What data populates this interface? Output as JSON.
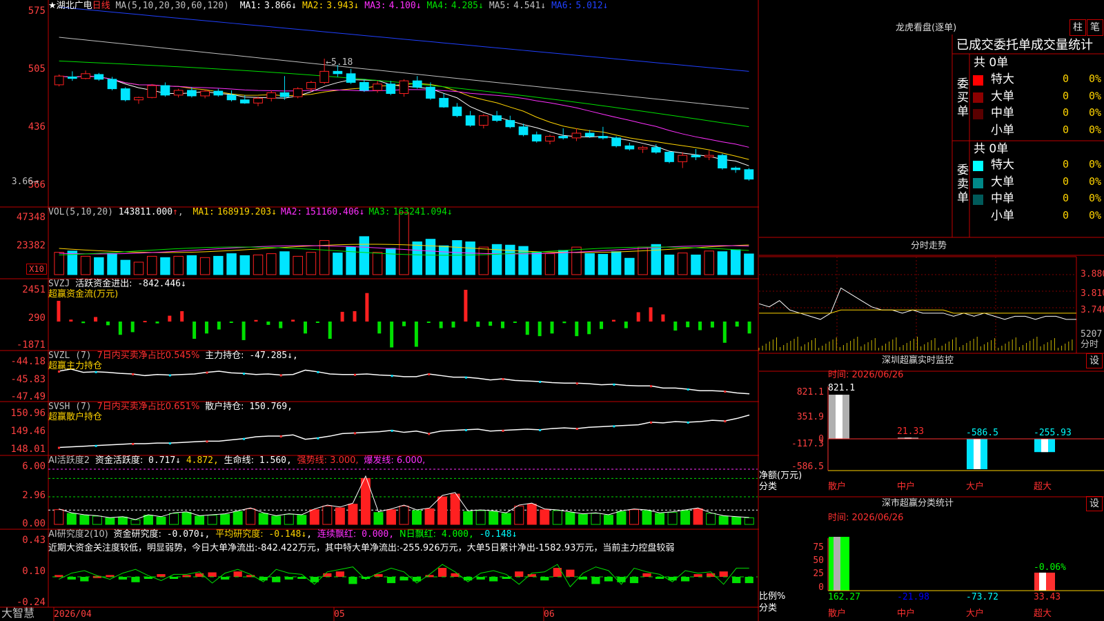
{
  "colors": {
    "up": "#ff2020",
    "down": "#00e5ff",
    "panel_border": "#c00000",
    "ma1": "#ffffff",
    "ma2": "#ffd400",
    "ma3": "#ff30ff",
    "ma4": "#00e000",
    "ma5": "#c0c0c0",
    "ma6": "#2040ff",
    "vol_label": "#c0c0c0"
  },
  "chart": {
    "stock_name": "★湖北广电",
    "period": "日线",
    "ma_params": "MA(5,10,20,30,60,120)",
    "ma": [
      {
        "label": "MA1:",
        "value": "3.866↓",
        "color": "#ffffff"
      },
      {
        "label": "MA2:",
        "value": "3.943↓",
        "color": "#ffd400"
      },
      {
        "label": "MA3:",
        "value": "4.100↓",
        "color": "#ff30ff"
      },
      {
        "label": "MA4:",
        "value": "4.285↓",
        "color": "#00e000"
      },
      {
        "label": "MA5:",
        "value": "4.541↓",
        "color": "#c0c0c0"
      },
      {
        "label": "MA6:",
        "value": "5.012↓",
        "color": "#2040ff"
      }
    ],
    "y_ticks": [
      "575",
      "505",
      "436",
      "366"
    ],
    "high_label": "5.18",
    "low_label": "3.66",
    "chart_data": {
      "type": "candlestick",
      "ylim": [
        3.5,
        5.85
      ],
      "high": 5.18,
      "low": 3.66,
      "ohlc": [
        [
          4.85,
          4.98,
          4.83,
          4.96
        ],
        [
          4.95,
          5.02,
          4.9,
          4.93
        ],
        [
          4.93,
          5.03,
          4.92,
          4.99
        ],
        [
          4.98,
          5.0,
          4.9,
          4.92
        ],
        [
          4.92,
          4.95,
          4.78,
          4.8
        ],
        [
          4.8,
          4.82,
          4.64,
          4.66
        ],
        [
          4.66,
          4.7,
          4.61,
          4.69
        ],
        [
          4.69,
          4.86,
          4.68,
          4.84
        ],
        [
          4.84,
          4.88,
          4.7,
          4.72
        ],
        [
          4.72,
          4.8,
          4.69,
          4.78
        ],
        [
          4.78,
          4.82,
          4.69,
          4.71
        ],
        [
          4.71,
          4.79,
          4.68,
          4.77
        ],
        [
          4.77,
          4.8,
          4.7,
          4.72
        ],
        [
          4.72,
          4.78,
          4.64,
          4.66
        ],
        [
          4.66,
          4.72,
          4.61,
          4.62
        ],
        [
          4.62,
          4.7,
          4.58,
          4.68
        ],
        [
          4.68,
          4.78,
          4.64,
          4.75
        ],
        [
          4.75,
          4.96,
          4.66,
          4.7
        ],
        [
          4.7,
          4.82,
          4.68,
          4.8
        ],
        [
          4.8,
          4.9,
          4.76,
          4.88
        ],
        [
          4.88,
          5.18,
          4.86,
          5.02
        ],
        [
          5.02,
          5.1,
          4.95,
          4.99
        ],
        [
          4.99,
          5.05,
          4.86,
          4.88
        ],
        [
          4.88,
          4.92,
          4.76,
          4.78
        ],
        [
          4.78,
          4.9,
          4.75,
          4.86
        ],
        [
          4.86,
          4.9,
          4.72,
          4.74
        ],
        [
          4.74,
          4.92,
          4.7,
          4.9
        ],
        [
          4.9,
          4.96,
          4.8,
          4.82
        ],
        [
          4.82,
          4.88,
          4.66,
          4.68
        ],
        [
          4.68,
          4.74,
          4.56,
          4.57
        ],
        [
          4.57,
          4.62,
          4.44,
          4.46
        ],
        [
          4.46,
          4.52,
          4.32,
          4.34
        ],
        [
          4.34,
          4.48,
          4.3,
          4.46
        ],
        [
          4.46,
          4.52,
          4.38,
          4.4
        ],
        [
          4.4,
          4.46,
          4.3,
          4.32
        ],
        [
          4.32,
          4.36,
          4.2,
          4.22
        ],
        [
          4.22,
          4.26,
          4.12,
          4.14
        ],
        [
          4.14,
          4.22,
          4.1,
          4.2
        ],
        [
          4.2,
          4.3,
          4.16,
          4.18
        ],
        [
          4.18,
          4.3,
          4.14,
          4.24
        ],
        [
          4.24,
          4.28,
          4.18,
          4.2
        ],
        [
          4.2,
          4.32,
          4.16,
          4.18
        ],
        [
          4.18,
          4.2,
          4.06,
          4.08
        ],
        [
          4.08,
          4.12,
          4.02,
          4.04
        ],
        [
          4.04,
          4.08,
          3.99,
          4.06
        ],
        [
          4.06,
          4.1,
          3.98,
          4.0
        ],
        [
          4.0,
          4.02,
          3.86,
          3.88
        ],
        [
          3.88,
          4.0,
          3.8,
          3.96
        ],
        [
          3.96,
          4.04,
          3.9,
          3.94
        ],
        [
          3.94,
          4.02,
          3.9,
          3.96
        ],
        [
          3.96,
          3.98,
          3.78,
          3.8
        ],
        [
          3.8,
          3.82,
          3.74,
          3.78
        ],
        [
          3.78,
          3.8,
          3.64,
          3.66
        ]
      ]
    }
  },
  "vol": {
    "title": "VOL(5,10,20)",
    "value": "143811.000",
    "arrow": "↑",
    "ma": [
      {
        "label": "MA1:",
        "value": "168919.203↓",
        "color": "#ffd400"
      },
      {
        "label": "MA2:",
        "value": "151160.406↓",
        "color": "#ff30ff"
      },
      {
        "label": "MA3:",
        "value": "163241.094↓",
        "color": "#00e000"
      }
    ],
    "y_ticks": [
      "47348",
      "23382"
    ],
    "unit": "X10",
    "chart_data": {
      "type": "bar",
      "ylim": [
        0,
        50000
      ],
      "values": [
        17000,
        18000,
        14000,
        13000,
        16000,
        11000,
        9500,
        14000,
        13000,
        14000,
        14500,
        13000,
        14000,
        16000,
        14500,
        15000,
        16000,
        17500,
        14000,
        17000,
        26000,
        16500,
        21000,
        29000,
        17000,
        20000,
        47348,
        25000,
        27000,
        22000,
        26000,
        25000,
        21000,
        23000,
        22500,
        21500,
        17000,
        16000,
        18500,
        21000,
        16000,
        15500,
        17500,
        12500,
        21000,
        23000,
        15000,
        16500,
        15000,
        18000,
        17500,
        19000,
        15800
      ]
    }
  },
  "svzj": {
    "title": "SVZJ",
    "label": "活跃资金进出:",
    "value": "-842.446↓",
    "sub": "超赢资金流(万元)",
    "y_ticks": [
      "2451",
      "290",
      "-1871"
    ],
    "chart_data": {
      "type": "bar",
      "ylim": [
        -1871,
        2451
      ],
      "values": [
        1600,
        150,
        -120,
        350,
        -280,
        -1000,
        -800,
        50,
        -140,
        450,
        800,
        -1300,
        -900,
        -600,
        -100,
        -1400,
        120,
        -250,
        -500,
        140,
        -900,
        -70,
        -1300,
        750,
        800,
        2200,
        -900,
        -1950,
        -350,
        -1900,
        -20,
        -500,
        -450,
        2451,
        -400,
        -320,
        -500,
        -100,
        -1000,
        -1100,
        -900,
        -120,
        -1100,
        -950,
        -560,
        130,
        -500,
        720,
        1100,
        550,
        -680,
        -430,
        -650,
        -450,
        -1600,
        -380,
        -900
      ]
    }
  },
  "svzl": {
    "title": "SVZL (7)",
    "desc": "7日内买卖净占比0.545%",
    "label": "主力持仓:",
    "value": "-47.285↓,",
    "sub": "超赢主力持仓",
    "y_ticks": [
      "-44.18",
      "-45.83",
      "-47.49"
    ],
    "chart_data": {
      "type": "line",
      "ylim": [
        -47.49,
        -44.18
      ],
      "values": [
        -45.2,
        -45.0,
        -45.3,
        -45.25,
        -45.3,
        -45.4,
        -45.45,
        -45.6,
        -45.5,
        -45.55,
        -45.5,
        -45.45,
        -45.3,
        -45.2,
        -45.35,
        -45.4,
        -45.5,
        -45.45,
        -45.55,
        -45.5,
        -45.1,
        -45.25,
        -45.45,
        -45.5,
        -45.5,
        -45.45,
        -45.55,
        -45.6,
        -45.7,
        -45.7,
        -45.45,
        -45.6,
        -45.75,
        -45.75,
        -45.85,
        -46.0,
        -45.9,
        -46.05,
        -46.1,
        -46.15,
        -46.25,
        -46.3,
        -46.3,
        -46.35,
        -46.45,
        -46.4,
        -46.5,
        -46.55,
        -46.55,
        -46.75,
        -46.75,
        -46.85,
        -47.0,
        -47.0,
        -47.05,
        -47.2,
        -47.285
      ]
    }
  },
  "svsh": {
    "title": "SVSH (7)",
    "desc": "7日内买卖净占比0.651%",
    "label": "散户持仓:",
    "value": "150.769",
    "suffix": ",",
    "sub": "超赢散户持仓",
    "y_ticks": [
      "150.96",
      "149.46",
      "148.01"
    ],
    "chart_data": {
      "type": "line",
      "ylim": [
        148.01,
        150.96
      ],
      "values": [
        148.2,
        148.25,
        148.3,
        148.35,
        148.4,
        148.45,
        148.5,
        148.5,
        148.55,
        148.55,
        148.6,
        148.65,
        148.7,
        148.7,
        148.8,
        148.9,
        149.05,
        149.1,
        149.1,
        149.2,
        148.85,
        148.95,
        149.1,
        149.3,
        149.35,
        149.4,
        149.45,
        149.55,
        149.4,
        149.5,
        149.3,
        149.5,
        149.55,
        149.6,
        149.65,
        149.5,
        149.55,
        149.6,
        149.65,
        149.6,
        149.7,
        149.75,
        149.7,
        149.8,
        149.85,
        149.9,
        149.95,
        150.0,
        150.2,
        150.15,
        150.25,
        150.2,
        150.25,
        150.35,
        150.3,
        150.5,
        150.769
      ]
    }
  },
  "ai1": {
    "title": "AI活跃度2",
    "label1": "资金活跃度:",
    "v1": "0.717↓",
    "v2": "4.872,",
    "label2": "生命线:",
    "v3": "1.560,",
    "strong": "强势线: 3.000,",
    "burst": "爆发线: 6.000,",
    "y_ticks": [
      "6.00",
      "2.96",
      "0.00"
    ],
    "chart_data": {
      "type": "bar",
      "ylim": [
        0,
        6.3
      ],
      "values": [
        1.6,
        1.2,
        1.0,
        0.9,
        0.7,
        0.8,
        0.5,
        1.0,
        0.8,
        1.2,
        1.3,
        0.9,
        1.0,
        1.1,
        1.4,
        1.7,
        1.2,
        0.9,
        1.1,
        1.0,
        1.6,
        2.0,
        1.8,
        2.2,
        5.0,
        1.3,
        1.6,
        2.0,
        1.5,
        1.7,
        3.0,
        3.3,
        1.4,
        1.5,
        1.4,
        1.2,
        2.0,
        2.2,
        1.6,
        1.5,
        1.3,
        1.1,
        1.2,
        1.0,
        1.4,
        1.6,
        1.5,
        1.2,
        1.3,
        1.5,
        1.7,
        1.2,
        0.9,
        0.8,
        0.717
      ]
    }
  },
  "ai2": {
    "title": "AI研究度2(10)",
    "label1": "资金研究度:",
    "v1": "-0.070↓",
    "label2": "平均研究度:",
    "v2": "-0.148↓",
    "label3": "连续飘红:",
    "v3": "0.000,",
    "label4": "N日飘红:",
    "v4": "4.000,",
    "v5": "-0.148↓",
    "text": "近期大资金关注度较低，明显弱势，今日大单净流出:-842.422万元，其中特大单净流出:-255.926万元，大单5日累计净出-1582.93万元，当前主力控盘较弱",
    "y_ticks": [
      "0.43",
      "0.10",
      "-0.24"
    ],
    "chart_data": {
      "type": "bar",
      "ylim": [
        -0.24,
        0.43
      ],
      "values": [
        0.02,
        -0.03,
        -0.05,
        0.01,
        0.02,
        -0.03,
        -0.06,
        -0.01,
        0.03,
        -0.02,
        0.02,
        0.04,
        0.05,
        -0.03,
        0.06,
        0.02,
        -0.04,
        -0.06,
        -0.03,
        -0.02,
        -0.06,
        0.04,
        0.06,
        -0.08,
        -0.02,
        0.03,
        -0.07,
        -0.04,
        -0.05,
        0.02,
        0.1,
        0.04,
        -0.04,
        -0.03,
        -0.05,
        -0.02,
        0.06,
        0.03,
        -0.04,
        0.1,
        0.08,
        -0.03,
        -0.08,
        -0.05,
        -0.06,
        -0.07,
        0.04,
        -0.02,
        -0.04,
        -0.05,
        0.03,
        0.04,
        0.06,
        -0.07,
        -0.07
      ]
    }
  },
  "xaxis": {
    "d0": "2026/04",
    "d1": "05",
    "d2": "06"
  },
  "footer": {
    "brand": "大智慧"
  },
  "right": {
    "longhu_title": "龙虎看盘(逐单)",
    "btn_zhu": "柱",
    "btn_bi": "笔",
    "stat_title": "已成交委托单成交量统计",
    "buy_label": "委买单",
    "sell_label": "委卖单",
    "total_buy": "共 0单",
    "total_sell": "共 0单",
    "buy_rows": [
      {
        "label": "特大",
        "value": "0",
        "pct": "0%",
        "color": "#ff0000"
      },
      {
        "label": "大单",
        "value": "0",
        "pct": "0%",
        "color": "#8c0000"
      },
      {
        "label": "中单",
        "value": "0",
        "pct": "0%",
        "color": "#5a0000"
      },
      {
        "label": "小单",
        "value": "0",
        "pct": "0%",
        "color": "#000000"
      }
    ],
    "sell_rows": [
      {
        "label": "特大",
        "value": "0",
        "pct": "0%",
        "color": "#00ffff"
      },
      {
        "label": "大单",
        "value": "0",
        "pct": "0%",
        "color": "#008888"
      },
      {
        "label": "中单",
        "value": "0",
        "pct": "0%",
        "color": "#005a5a"
      },
      {
        "label": "小单",
        "value": "0",
        "pct": "0%",
        "color": "#000000"
      }
    ],
    "fenshi_title": "分时走势",
    "fenshi_ticks": [
      "3.880",
      "3.810",
      "3.740"
    ],
    "fenshi_vol": "5207",
    "fenshi_vol_label": "分时",
    "fenshi_data": {
      "price": [
        3.75,
        3.74,
        3.76,
        3.73,
        3.72,
        3.71,
        3.7,
        3.72,
        3.8,
        3.78,
        3.76,
        3.74,
        3.73,
        3.73,
        3.72,
        3.73,
        3.72,
        3.72,
        3.72,
        3.71,
        3.72,
        3.71,
        3.72,
        3.71,
        3.7,
        3.71,
        3.71,
        3.7,
        3.71,
        3.71,
        3.7,
        3.7
      ],
      "avg": [
        3.72,
        3.72,
        3.72,
        3.72,
        3.72,
        3.72,
        3.72,
        3.72,
        3.73,
        3.73,
        3.73,
        3.73,
        3.73,
        3.73,
        3.73,
        3.73,
        3.73,
        3.73,
        3.73,
        3.72,
        3.72,
        3.72,
        3.72,
        3.72,
        3.72,
        3.72,
        3.72,
        3.72,
        3.72,
        3.72,
        3.72,
        3.72
      ],
      "ylim": [
        3.68,
        3.9
      ]
    },
    "sz_monitor_title": "深圳超赢实时监控",
    "sz_monitor_btn": "设",
    "monitor_time": "时间: 2026/06/26",
    "monitor_ticks": [
      "821.1",
      "351.9",
      "0",
      "-117.3",
      "-586.5"
    ],
    "monitor_ylabel": "净额(万元)",
    "monitor_xlabel": "分类",
    "monitor_cats": [
      {
        "label": "散户",
        "value": "821.1",
        "color": "#ff3030",
        "vcolor": "#ffffff"
      },
      {
        "label": "中户",
        "value": "21.33",
        "color": "#ff3030",
        "vcolor": "#ff3030"
      },
      {
        "label": "大户",
        "value": "-586.5",
        "color": "#ff3030",
        "vcolor": "#00ffff"
      },
      {
        "label": "超大",
        "value": "-255.93",
        "color": "#ff3030",
        "vcolor": "#00ffff"
      }
    ],
    "monitor_data": {
      "type": "bar",
      "ylim": [
        -586.5,
        821.1
      ],
      "values": [
        821.1,
        21.33,
        -586.5,
        -255.93
      ]
    },
    "sz_stat_title": "深市超赢分类统计",
    "sz_stat_btn": "设",
    "stat_time": "时间: 2026/06/26",
    "stat_ticks": [
      "75",
      "50",
      "25",
      "0"
    ],
    "stat_ylabel": "比例%",
    "stat_xlabel": "分类",
    "stat_top": [
      "",
      "",
      "",
      "-0.06%"
    ],
    "stat_vals": [
      {
        "label": "散户",
        "value": "162.27",
        "color": "#00ff00"
      },
      {
        "label": "中户",
        "value": "-21.98",
        "color": "#0000ff"
      },
      {
        "label": "大户",
        "value": "-73.72",
        "color": "#00ffff"
      },
      {
        "label": "超大",
        "value": "33.43",
        "color": "#ff3030"
      }
    ],
    "stat_data": {
      "type": "bar",
      "ylim": [
        0,
        100
      ],
      "values": [
        100,
        0,
        0,
        33.43
      ]
    }
  }
}
